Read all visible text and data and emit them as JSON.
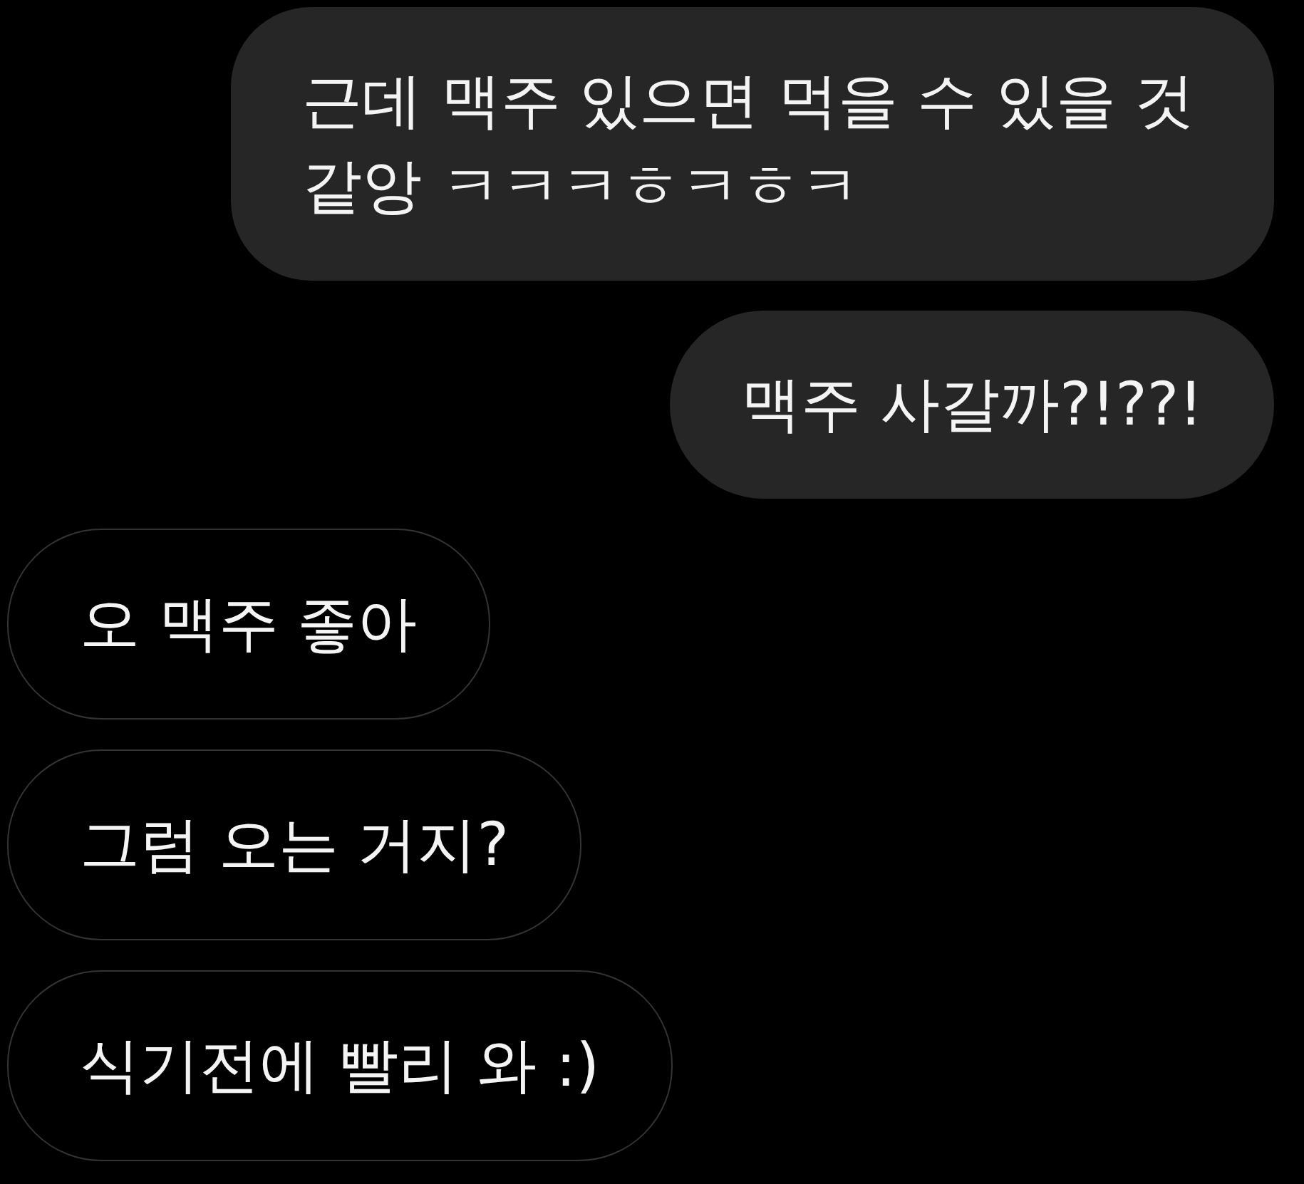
{
  "messages": [
    {
      "kind": "sent",
      "text": "근데 맥주 있으면 먹을 수 있을 것 같앙 ㅋㅋㅋㅎㅋㅎㅋ"
    },
    {
      "kind": "sent",
      "text": "맥주 사갈까?!??!"
    },
    {
      "kind": "received",
      "text": "오 맥주 좋아"
    },
    {
      "kind": "received",
      "text": "그럼 오는 거지?"
    },
    {
      "kind": "received",
      "text": "식기전에 빨리 와 :)"
    }
  ]
}
